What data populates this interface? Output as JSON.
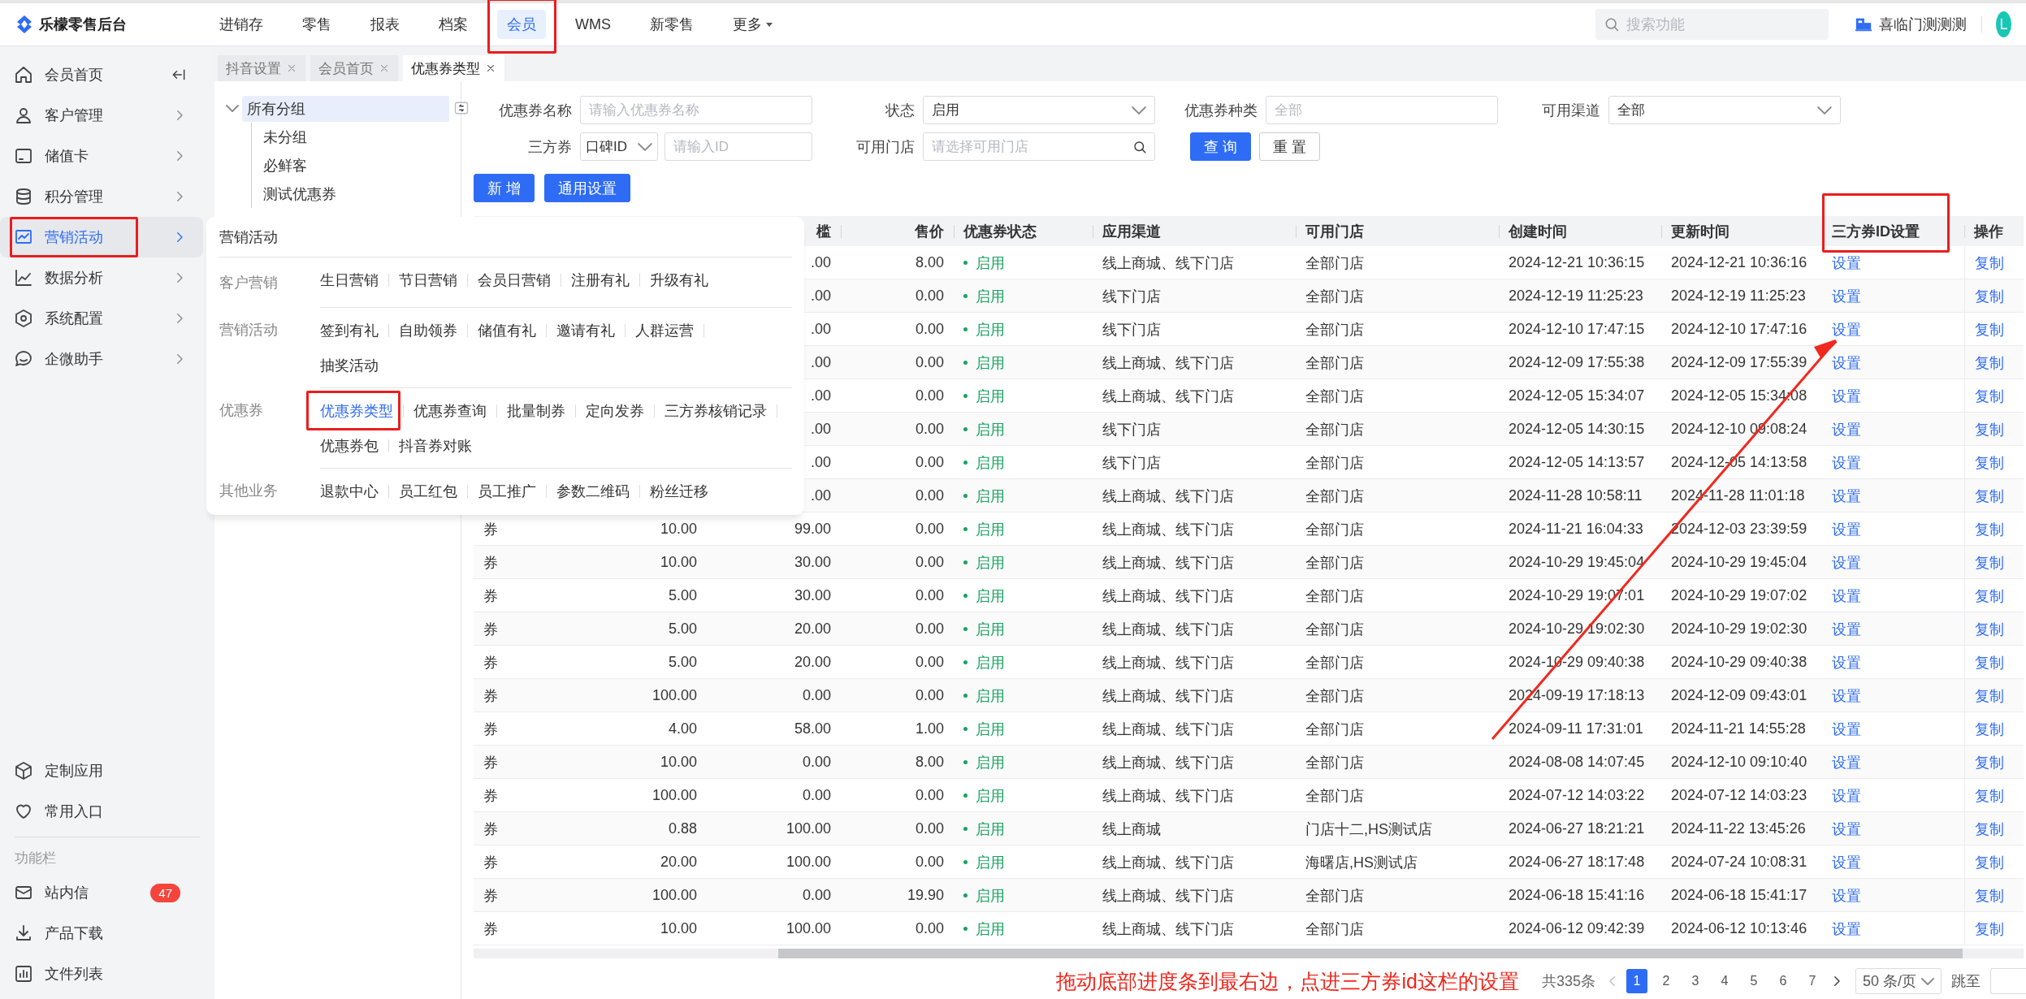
{
  "top_bar": {
    "logo": "乐檬零售后台",
    "nav": [
      {
        "label": "进销存",
        "kind": "link",
        "selected": false,
        "highlighted": false
      },
      {
        "label": "零售",
        "kind": "link",
        "selected": false,
        "highlighted": false
      },
      {
        "label": "报表",
        "kind": "link",
        "selected": false,
        "highlighted": false
      },
      {
        "label": "档案",
        "kind": "link",
        "selected": false,
        "highlighted": false
      },
      {
        "label": "会员",
        "kind": "link",
        "selected": true,
        "highlighted": true
      },
      {
        "label": "WMS",
        "kind": "link",
        "selected": false,
        "highlighted": false
      },
      {
        "label": "新零售",
        "kind": "link",
        "selected": false,
        "highlighted": false
      },
      {
        "label": "更多",
        "kind": "dropdown",
        "selected": false,
        "highlighted": false
      }
    ],
    "search": {
      "placeholder": "搜索功能"
    },
    "store": "喜临门测测测",
    "avatar": "L"
  },
  "sidebar": {
    "items": [
      {
        "label": "会员首页",
        "kind": "page",
        "selected": false,
        "highlighted": false
      },
      {
        "label": "客户管理",
        "kind": "group",
        "selected": false,
        "highlighted": false
      },
      {
        "label": "储值卡",
        "kind": "group",
        "selected": false,
        "highlighted": false
      },
      {
        "label": "积分管理",
        "kind": "group",
        "selected": false,
        "highlighted": false
      },
      {
        "label": "营销活动",
        "kind": "group",
        "selected": true,
        "highlighted": true
      },
      {
        "label": "数据分析",
        "kind": "group",
        "selected": false,
        "highlighted": false
      },
      {
        "label": "系统配置",
        "kind": "group",
        "selected": false,
        "highlighted": false
      },
      {
        "label": "企微助手",
        "kind": "group",
        "selected": false,
        "highlighted": false
      }
    ],
    "shortcuts": [
      {
        "label": "定制应用"
      },
      {
        "label": "常用入口"
      }
    ],
    "section_title": "功能栏",
    "tools": [
      {
        "label": "站内信",
        "badge": "47"
      },
      {
        "label": "产品下载"
      },
      {
        "label": "文件列表"
      }
    ]
  },
  "tabs": [
    {
      "label": "抖音设置",
      "selected": false
    },
    {
      "label": "会员首页",
      "selected": false
    },
    {
      "label": "优惠券类型",
      "selected": true
    }
  ],
  "tree": {
    "label": "所有分组",
    "expanded": true,
    "selected": true,
    "children": [
      {
        "label": "未分组",
        "selected": false
      },
      {
        "label": "必鲜客",
        "selected": false
      },
      {
        "label": "测试优惠券",
        "selected": false
      }
    ]
  },
  "filters": {
    "rows": [
      [
        {
          "label": "优惠券名称",
          "kind": "input",
          "placeholder": "请输入优惠券名称"
        },
        {
          "label": "状态",
          "kind": "select",
          "value": "启用"
        },
        {
          "label": "优惠券种类",
          "kind": "input",
          "placeholder": "全部"
        },
        {
          "label": "可用渠道",
          "kind": "select",
          "value": "全部"
        }
      ],
      [
        {
          "label": "三方券",
          "kind": "combo",
          "value": "口碑ID",
          "placeholder": "请输入ID"
        },
        {
          "label": "可用门店",
          "kind": "search",
          "placeholder": "请选择可用门店"
        }
      ]
    ],
    "buttons": [
      {
        "label": "查 询",
        "primary": true
      },
      {
        "label": "重 置",
        "primary": false
      }
    ]
  },
  "actions": [
    {
      "label": "新 增",
      "primary": true
    },
    {
      "label": "通用设置",
      "primary": true
    }
  ],
  "table": {
    "columns": [
      {},
      {},
      {
        "label": "槛",
        "highlighted": false
      },
      {
        "label": "售价",
        "highlighted": false
      },
      {
        "label": "优惠券状态",
        "highlighted": false
      },
      {
        "label": "应用渠道",
        "highlighted": false
      },
      {
        "label": "可用门店",
        "highlighted": false
      },
      {
        "label": "创建时间",
        "highlighted": false
      },
      {
        "label": "更新时间",
        "highlighted": false
      },
      {
        "label": "三方券ID设置",
        "highlighted": true
      },
      {
        "label": "操作",
        "highlighted": false
      }
    ],
    "rows": [
      {
        "column_3": ".00",
        "price": "8.00",
        "status": {
          "label": "启用",
          "color": "#1aa260"
        },
        "channel": "线上商城、线下门店",
        "store": "全部门店",
        "created": "2024-12-21 10:36:15",
        "updated": "2024-12-21 10:36:16",
        "third_party_id": "设置",
        "action": "复制"
      },
      {
        "column_3": ".00",
        "price": "0.00",
        "status": {
          "label": "启用",
          "color": "#1aa260"
        },
        "channel": "线下门店",
        "store": "全部门店",
        "created": "2024-12-19 11:25:23",
        "updated": "2024-12-19 11:25:23",
        "third_party_id": "设置",
        "action": "复制"
      },
      {
        "column_3": ".00",
        "price": "0.00",
        "status": {
          "label": "启用",
          "color": "#1aa260"
        },
        "channel": "线下门店",
        "store": "全部门店",
        "created": "2024-12-10 17:47:15",
        "updated": "2024-12-10 17:47:16",
        "third_party_id": "设置",
        "action": "复制"
      },
      {
        "column_3": ".00",
        "price": "0.00",
        "status": {
          "label": "启用",
          "color": "#1aa260"
        },
        "channel": "线上商城、线下门店",
        "store": "全部门店",
        "created": "2024-12-09 17:55:38",
        "updated": "2024-12-09 17:55:39",
        "third_party_id": "设置",
        "action": "复制"
      },
      {
        "column_3": ".00",
        "price": "0.00",
        "status": {
          "label": "启用",
          "color": "#1aa260"
        },
        "channel": "线上商城、线下门店",
        "store": "全部门店",
        "created": "2024-12-05 15:34:07",
        "updated": "2024-12-05 15:34:08",
        "third_party_id": "设置",
        "action": "复制"
      },
      {
        "column_3": ".00",
        "price": "0.00",
        "status": {
          "label": "启用",
          "color": "#1aa260"
        },
        "channel": "线下门店",
        "store": "全部门店",
        "created": "2024-12-05 14:30:15",
        "updated": "2024-12-10 09:08:24",
        "third_party_id": "设置",
        "action": "复制"
      },
      {
        "column_3": ".00",
        "price": "0.00",
        "status": {
          "label": "启用",
          "color": "#1aa260"
        },
        "channel": "线下门店",
        "store": "全部门店",
        "created": "2024-12-05 14:13:57",
        "updated": "2024-12-05 14:13:58",
        "third_party_id": "设置",
        "action": "复制"
      },
      {
        "column_3": ".00",
        "price": "0.00",
        "status": {
          "label": "启用",
          "color": "#1aa260"
        },
        "channel": "线上商城、线下门店",
        "store": "全部门店",
        "created": "2024-11-28 10:58:11",
        "updated": "2024-11-28 11:01:18",
        "third_party_id": "设置",
        "action": "复制"
      },
      {
        "column_1": "券",
        "column_2": "10.00",
        "column_3": "99.00",
        "price": "0.00",
        "status": {
          "label": "启用",
          "color": "#1aa260"
        },
        "channel": "线上商城、线下门店",
        "store": "全部门店",
        "created": "2024-11-21 16:04:33",
        "updated": "2024-12-03 23:39:59",
        "third_party_id": "设置",
        "action": "复制"
      },
      {
        "column_1": "券",
        "column_2": "10.00",
        "column_3": "30.00",
        "price": "0.00",
        "status": {
          "label": "启用",
          "color": "#1aa260"
        },
        "channel": "线上商城、线下门店",
        "store": "全部门店",
        "created": "2024-10-29 19:45:04",
        "updated": "2024-10-29 19:45:04",
        "third_party_id": "设置",
        "action": "复制"
      },
      {
        "column_1": "券",
        "column_2": "5.00",
        "column_3": "30.00",
        "price": "0.00",
        "status": {
          "label": "启用",
          "color": "#1aa260"
        },
        "channel": "线上商城、线下门店",
        "store": "全部门店",
        "created": "2024-10-29 19:07:01",
        "updated": "2024-10-29 19:07:02",
        "third_party_id": "设置",
        "action": "复制"
      },
      {
        "column_1": "券",
        "column_2": "5.00",
        "column_3": "20.00",
        "price": "0.00",
        "status": {
          "label": "启用",
          "color": "#1aa260"
        },
        "channel": "线上商城、线下门店",
        "store": "全部门店",
        "created": "2024-10-29 19:02:30",
        "updated": "2024-10-29 19:02:30",
        "third_party_id": "设置",
        "action": "复制"
      },
      {
        "column_1": "券",
        "column_2": "5.00",
        "column_3": "20.00",
        "price": "0.00",
        "status": {
          "label": "启用",
          "color": "#1aa260"
        },
        "channel": "线上商城、线下门店",
        "store": "全部门店",
        "created": "2024-10-29 09:40:38",
        "updated": "2024-10-29 09:40:38",
        "third_party_id": "设置",
        "action": "复制"
      },
      {
        "column_1": "券",
        "column_2": "100.00",
        "column_3": "0.00",
        "price": "0.00",
        "status": {
          "label": "启用",
          "color": "#1aa260"
        },
        "channel": "线上商城、线下门店",
        "store": "全部门店",
        "created": "2024-09-19 17:18:13",
        "updated": "2024-12-09 09:43:01",
        "third_party_id": "设置",
        "action": "复制"
      },
      {
        "column_1": "券",
        "column_2": "4.00",
        "column_3": "58.00",
        "price": "1.00",
        "status": {
          "label": "启用",
          "color": "#1aa260"
        },
        "channel": "线上商城、线下门店",
        "store": "全部门店",
        "created": "2024-09-11 17:31:01",
        "updated": "2024-11-21 14:55:28",
        "third_party_id": "设置",
        "action": "复制"
      },
      {
        "column_1": "券",
        "column_2": "10.00",
        "column_3": "0.00",
        "price": "8.00",
        "status": {
          "label": "启用",
          "color": "#1aa260"
        },
        "channel": "线上商城、线下门店",
        "store": "全部门店",
        "created": "2024-08-08 14:07:45",
        "updated": "2024-12-10 09:10:40",
        "third_party_id": "设置",
        "action": "复制"
      },
      {
        "column_1": "券",
        "column_2": "100.00",
        "column_3": "0.00",
        "price": "0.00",
        "status": {
          "label": "启用",
          "color": "#1aa260"
        },
        "channel": "线上商城、线下门店",
        "store": "全部门店",
        "created": "2024-07-12 14:03:22",
        "updated": "2024-07-12 14:03:23",
        "third_party_id": "设置",
        "action": "复制"
      },
      {
        "column_1": "券",
        "column_2": "0.88",
        "column_3": "100.00",
        "price": "0.00",
        "status": {
          "label": "启用",
          "color": "#1aa260"
        },
        "channel": "线上商城",
        "store": "门店十二,HS测试店",
        "created": "2024-06-27 18:21:21",
        "updated": "2024-11-22 13:45:26",
        "third_party_id": "设置",
        "action": "复制"
      },
      {
        "column_1": "券",
        "column_2": "20.00",
        "column_3": "100.00",
        "price": "0.00",
        "status": {
          "label": "启用",
          "color": "#1aa260"
        },
        "channel": "线上商城、线下门店",
        "store": "海曙店,HS测试店",
        "created": "2024-06-27 18:17:48",
        "updated": "2024-07-24 10:08:31",
        "third_party_id": "设置",
        "action": "复制"
      },
      {
        "column_1": "券",
        "column_2": "100.00",
        "column_3": "0.00",
        "price": "19.90",
        "status": {
          "label": "启用",
          "color": "#1aa260"
        },
        "channel": "线上商城、线下门店",
        "store": "全部门店",
        "created": "2024-06-18 15:41:16",
        "updated": "2024-06-18 15:41:17",
        "third_party_id": "设置",
        "action": "复制"
      },
      {
        "column_1": "券",
        "column_2": "10.00",
        "column_3": "100.00",
        "price": "0.00",
        "status": {
          "label": "启用",
          "color": "#1aa260"
        },
        "channel": "线上商城、线下门店",
        "store": "全部门店",
        "created": "2024-06-12 09:42:39",
        "updated": "2024-06-12 10:13:46",
        "third_party_id": "设置",
        "action": "复制"
      }
    ]
  },
  "pagination": {
    "total": "共335条",
    "pages": [
      {
        "label": "1",
        "selected": true
      },
      {
        "label": "2",
        "selected": false
      },
      {
        "label": "3",
        "selected": false
      },
      {
        "label": "4",
        "selected": false
      },
      {
        "label": "5",
        "selected": false
      },
      {
        "label": "6",
        "selected": false
      },
      {
        "label": "7",
        "selected": false
      }
    ],
    "page_size": "50 条/页",
    "jump_label": "跳至"
  },
  "menu": {
    "title": "营销活动",
    "groups": [
      {
        "label": "客户营销",
        "lines": [
          [
            {
              "label": "生日营销",
              "selected": false,
              "highlighted": false
            },
            {
              "label": "节日营销",
              "selected": false,
              "highlighted": false
            },
            {
              "label": "会员日营销",
              "selected": false,
              "highlighted": false
            },
            {
              "label": "注册有礼",
              "selected": false,
              "highlighted": false
            },
            {
              "label": "升级有礼",
              "selected": false,
              "highlighted": false
            }
          ]
        ]
      },
      {
        "label": "营销活动",
        "lines": [
          [
            {
              "label": "签到有礼",
              "selected": false,
              "highlighted": false
            },
            {
              "label": "自助领券",
              "selected": false,
              "highlighted": false
            },
            {
              "label": "储值有礼",
              "selected": false,
              "highlighted": false
            },
            {
              "label": "邀请有礼",
              "selected": false,
              "highlighted": false
            },
            {
              "label": "人群运营",
              "selected": false,
              "highlighted": false
            }
          ],
          [
            {
              "label": "抽奖活动",
              "selected": false,
              "highlighted": false
            }
          ]
        ]
      },
      {
        "label": "优惠券",
        "lines": [
          [
            {
              "label": "优惠券类型",
              "selected": true,
              "highlighted": true
            },
            {
              "label": "优惠券查询",
              "selected": false,
              "highlighted": false
            },
            {
              "label": "批量制券",
              "selected": false,
              "highlighted": false
            },
            {
              "label": "定向发券",
              "selected": false,
              "highlighted": false
            },
            {
              "label": "三方券核销记录",
              "selected": false,
              "highlighted": false
            }
          ],
          [
            {
              "label": "优惠券包",
              "selected": false,
              "highlighted": false
            },
            {
              "label": "抖音券对账",
              "selected": false,
              "highlighted": false
            }
          ]
        ]
      },
      {
        "label": "其他业务",
        "lines": [
          [
            {
              "label": "退款中心",
              "selected": false,
              "highlighted": false
            },
            {
              "label": "员工红包",
              "selected": false,
              "highlighted": false
            },
            {
              "label": "员工推广",
              "selected": false,
              "highlighted": false
            },
            {
              "label": "参数二维码",
              "selected": false,
              "highlighted": false
            },
            {
              "label": "粉丝迁移",
              "selected": false,
              "highlighted": false
            }
          ]
        ]
      }
    ]
  },
  "annotation": {
    "text": "拖动底部进度条到最右边，点进三方券id这栏的设置",
    "arrow": true
  }
}
